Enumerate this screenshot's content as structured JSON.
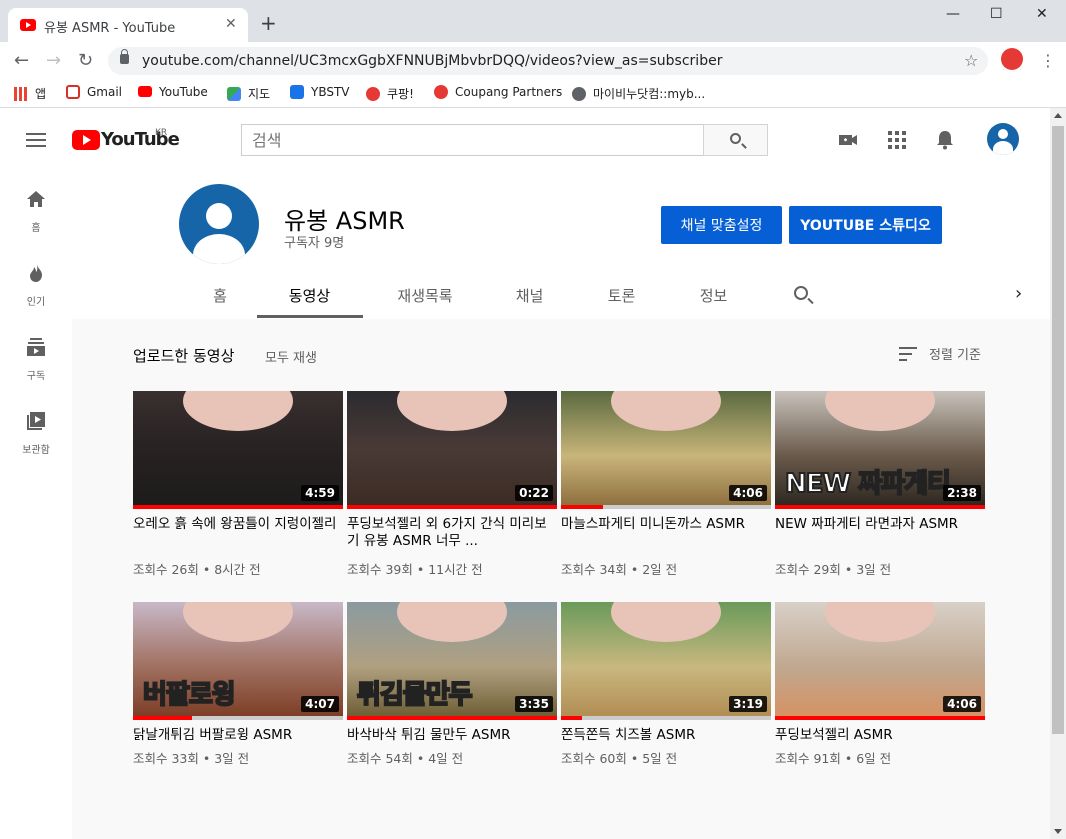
{
  "browser": {
    "tab_title": "유봉 ASMR - YouTube",
    "url": "youtube.com/channel/UC3mcxGgbXFNNUBjMbvbrDQQ/videos?view_as=subscriber",
    "bookmarks": [
      {
        "label": "앱",
        "icon": "apps-grid-icon"
      },
      {
        "label": "Gmail",
        "icon": "gmail-icon"
      },
      {
        "label": "YouTube",
        "icon": "youtube-icon"
      },
      {
        "label": "지도",
        "icon": "maps-icon"
      },
      {
        "label": "YBSTV",
        "icon": "ybstv-icon"
      },
      {
        "label": "쿠팡!",
        "icon": "coupang-icon"
      },
      {
        "label": "Coupang Partners",
        "icon": "coupang-icon"
      },
      {
        "label": "마이비누닷컴::myb...",
        "icon": "globe-icon"
      }
    ]
  },
  "youtube": {
    "logo_text": "YouTube",
    "region": "KR",
    "search_placeholder": "검색",
    "guide": [
      {
        "label": "홈",
        "icon": "home-icon"
      },
      {
        "label": "인기",
        "icon": "trending-icon"
      },
      {
        "label": "구독",
        "icon": "subscriptions-icon"
      },
      {
        "label": "보관함",
        "icon": "library-icon"
      }
    ]
  },
  "channel": {
    "name": "유봉 ASMR",
    "subscribers": "구독자 9명",
    "customize_button": "채널 맞춤설정",
    "studio_button": "YOUTUBE 스튜디오",
    "tabs": [
      "홈",
      "동영상",
      "재생목록",
      "채널",
      "토론",
      "정보"
    ],
    "active_tab": "동영상"
  },
  "section": {
    "title": "업로드한 동영상",
    "play_all": "모두 재생",
    "sort_label": "정렬 기준"
  },
  "videos": [
    {
      "title": "오레오 흙 속에 왕꿈틀이 지렁이젤리",
      "views": "조회수 26회",
      "age": "8시간 전",
      "duration": "4:59",
      "watched": 1.0,
      "overlay": ""
    },
    {
      "title": "푸딩보석젤리 외 6가지 간식 미리보기 유봉 ASMR 너무 ...",
      "views": "조회수 39회",
      "age": "11시간 전",
      "duration": "0:22",
      "watched": 1.0,
      "overlay": ""
    },
    {
      "title": "마늘스파게티 미니돈까스 ASMR",
      "views": "조회수 34회",
      "age": "2일 전",
      "duration": "4:06",
      "watched": 0.2,
      "overlay": ""
    },
    {
      "title": "NEW 짜파게티 라면과자 ASMR",
      "views": "조회수 29회",
      "age": "3일 전",
      "duration": "2:38",
      "watched": 1.0,
      "overlay": "NEW 짜파게티"
    },
    {
      "title": "닭날개튀김 버팔로윙 ASMR",
      "views": "조회수 33회",
      "age": "3일 전",
      "duration": "4:07",
      "watched": 0.28,
      "overlay": "버팔로윙"
    },
    {
      "title": "바삭바삭 튀김 물만두 ASMR",
      "views": "조회수 54회",
      "age": "4일 전",
      "duration": "3:35",
      "watched": 1.0,
      "overlay": "튀김물만두"
    },
    {
      "title": "쫀득쫀득 치즈볼 ASMR",
      "views": "조회수 60회",
      "age": "5일 전",
      "duration": "3:19",
      "watched": 0.1,
      "overlay": ""
    },
    {
      "title": "푸딩보석젤리 ASMR",
      "views": "조회수 91회",
      "age": "6일 전",
      "duration": "4:06",
      "watched": 1.0,
      "overlay": ""
    }
  ],
  "colors": {
    "youtube_red": "#ff0000",
    "studio_blue": "#065fd4",
    "avatar_blue": "#1565a8"
  }
}
